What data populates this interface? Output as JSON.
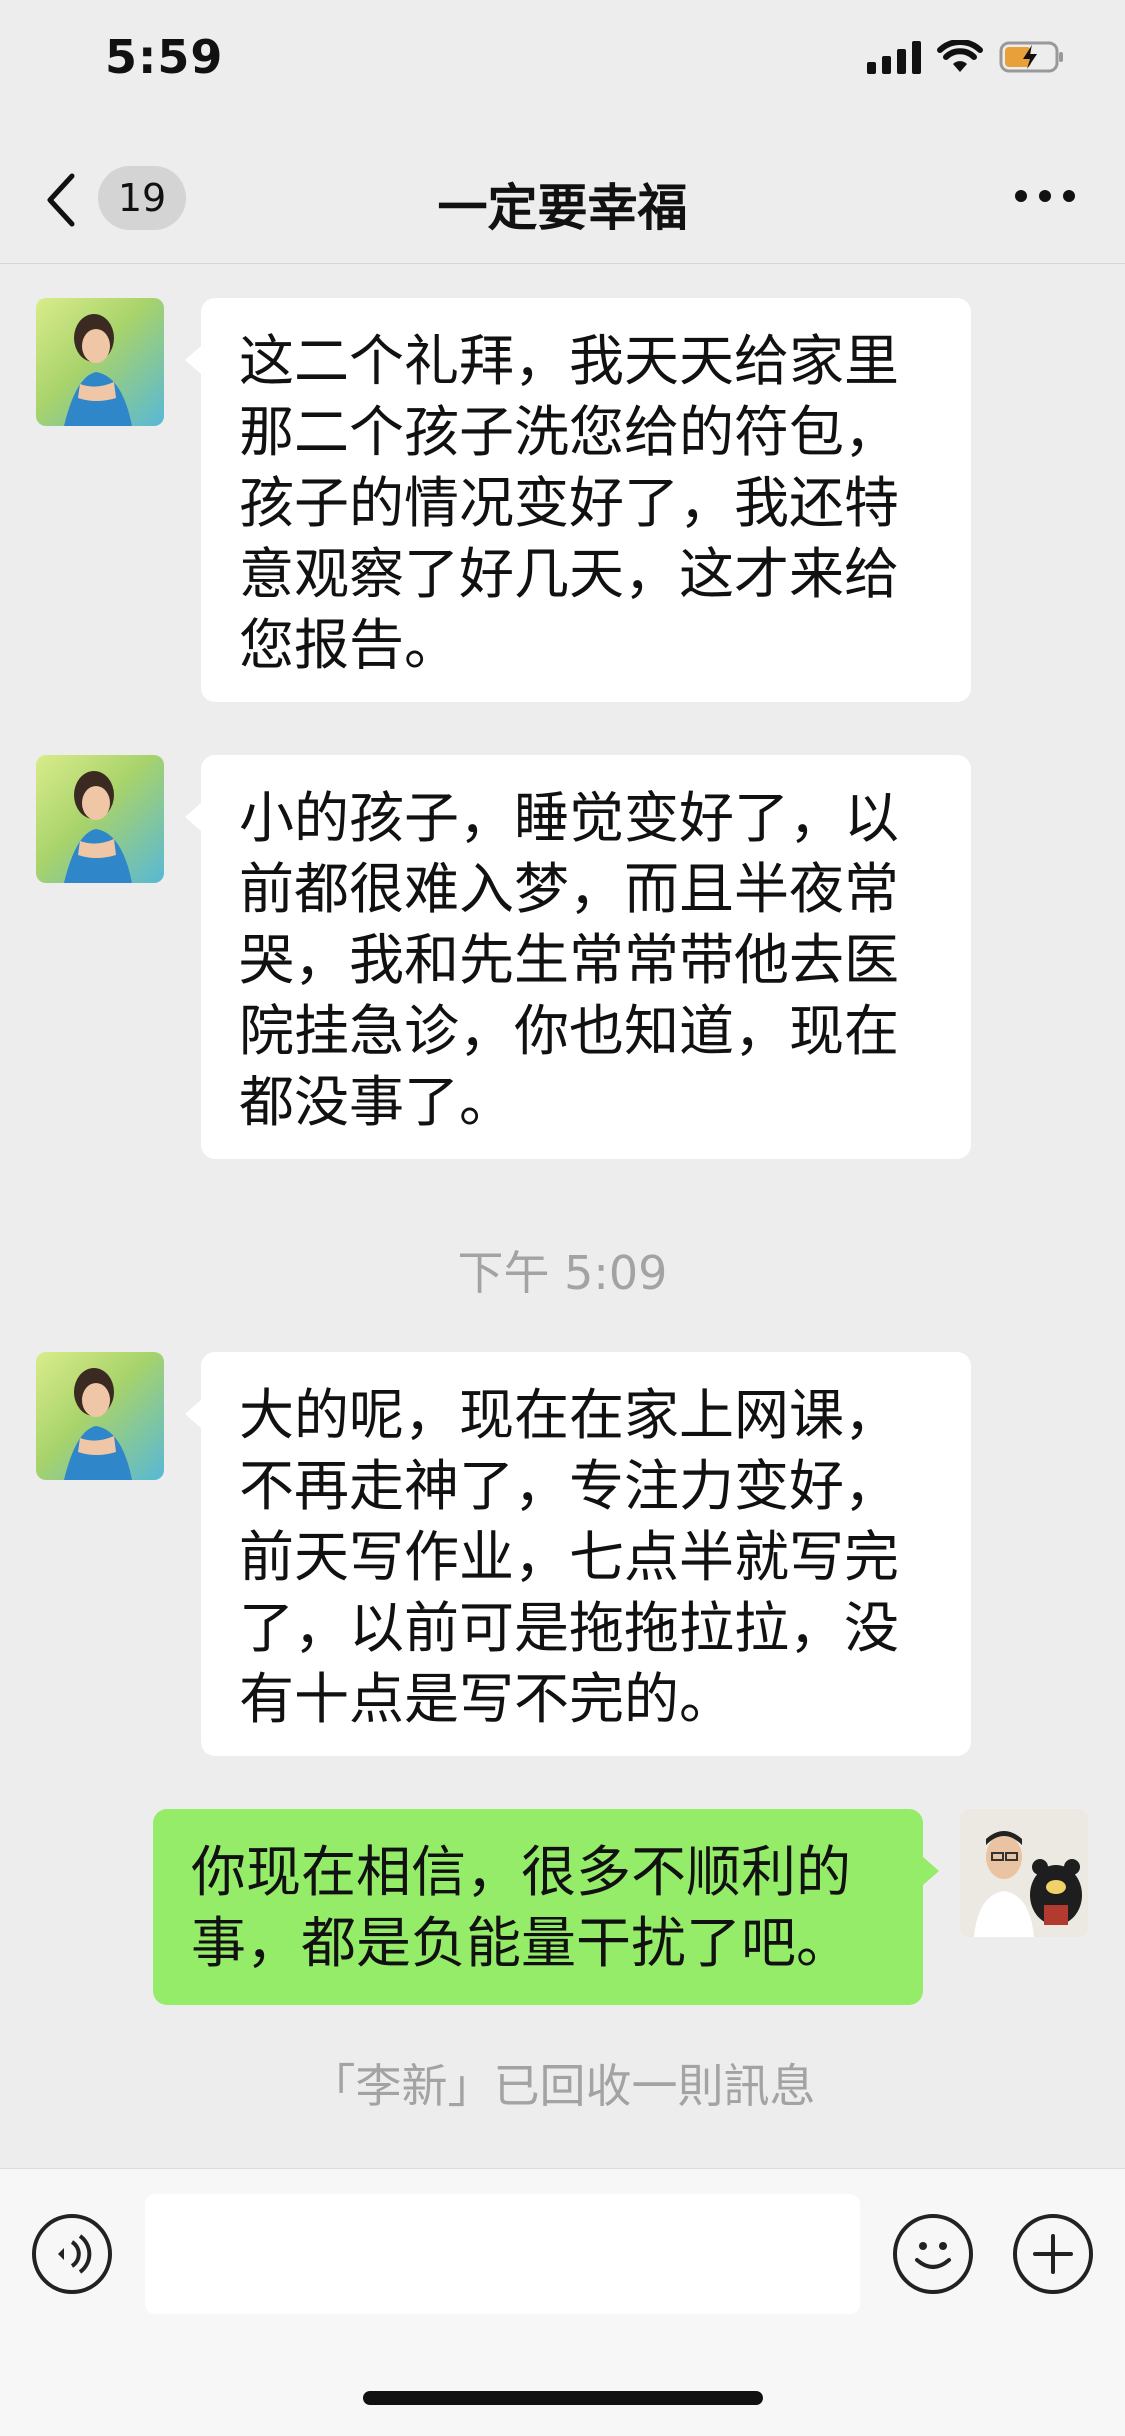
{
  "status_bar": {
    "time": "5:59"
  },
  "header": {
    "back_badge_count": "19",
    "title": "一定要幸福"
  },
  "messages": [
    {
      "side": "in",
      "text": "这二个礼拜，我天天给家里那二个孩子洗您给的符包，孩子的情况变好了，我还特意观察了好几天，这才来给您报告。"
    },
    {
      "side": "in",
      "text": "小的孩子，睡觉变好了，以前都很难入梦，而且半夜常哭，我和先生常常带他去医院挂急诊，你也知道，现在都没事了。"
    },
    {
      "side": "in",
      "text": "大的呢，现在在家上网课，不再走神了，专注力变好，前天写作业，七点半就写完了，以前可是拖拖拉拉，没有十点是写不完的。"
    },
    {
      "side": "out",
      "text": "你现在相信，很多不顺利的事，都是负能量干扰了吧。"
    }
  ],
  "timestamp": "下午 5:09",
  "system_note": "「李新」已回收一則訊息",
  "input": {
    "value": "",
    "placeholder": ""
  },
  "icons": {
    "back": "chevron-left-icon",
    "more": "more-dots-icon",
    "voice": "voice-icon",
    "emoji": "emoji-icon",
    "plus": "plus-icon"
  },
  "colors": {
    "incoming_bubble": "#ffffff",
    "outgoing_bubble": "#95ec69",
    "background": "#ededed",
    "system_text": "#a3a3a3"
  }
}
